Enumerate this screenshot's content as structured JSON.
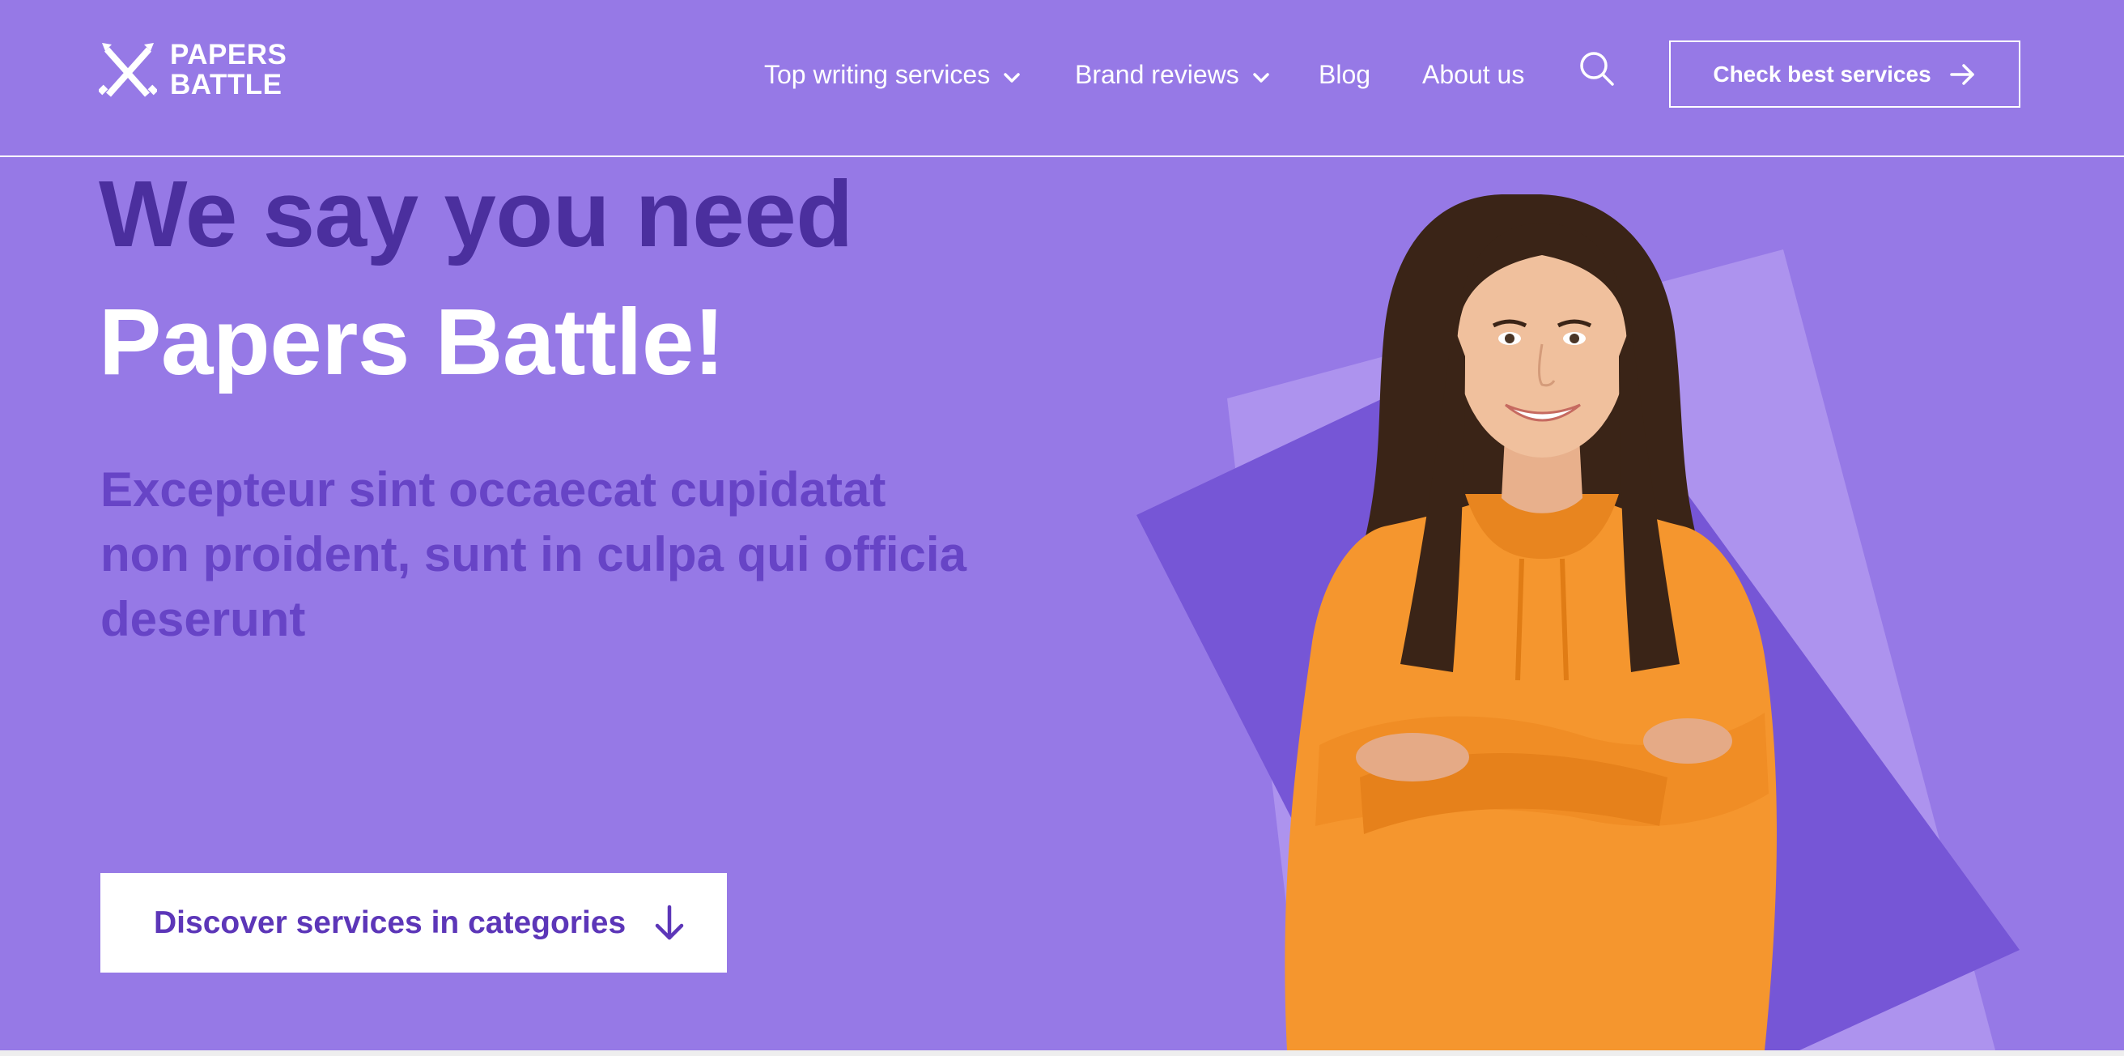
{
  "brand": {
    "logo_line1": "PAPERS",
    "logo_line2": "BATTLE",
    "accent": "#9679E6",
    "dark_accent": "#4B2F9E",
    "mid_accent": "#6744C6"
  },
  "nav": {
    "items": [
      {
        "label": "Top writing services",
        "has_dropdown": true
      },
      {
        "label": "Brand reviews",
        "has_dropdown": true
      },
      {
        "label": "Blog",
        "has_dropdown": false
      },
      {
        "label": "About us",
        "has_dropdown": false
      }
    ],
    "search_icon": "search-icon",
    "cta_label": "Check best services"
  },
  "hero": {
    "headline_line1": "We say you need",
    "headline_line2": "Papers Battle!",
    "subtitle": "Excepteur sint occaecat cupidatat non proident, sunt in culpa qui officia deserunt",
    "discover_label": "Discover services in categories"
  }
}
